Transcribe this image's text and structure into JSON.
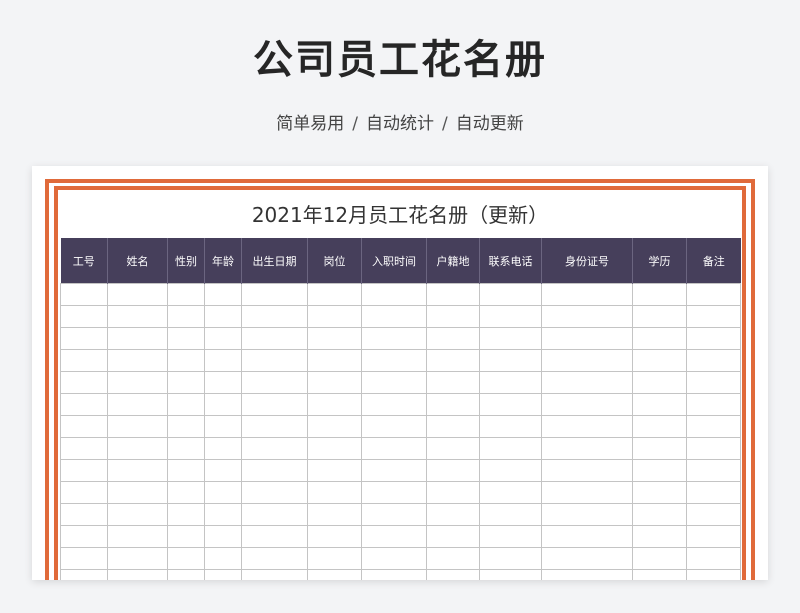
{
  "header": {
    "title": "公司员工花名册",
    "tagline": [
      "简单易用",
      "自动统计",
      "自动更新"
    ],
    "separator": "/"
  },
  "sheet": {
    "title": "2021年12月员工花名册（更新）",
    "columns": [
      "工号",
      "姓名",
      "性别",
      "年龄",
      "出生日期",
      "岗位",
      "入职时间",
      "户籍地",
      "联系电话",
      "身份证号",
      "学历",
      "备注"
    ],
    "rows": [
      [
        "",
        "",
        "",
        "",
        "",
        "",
        "",
        "",
        "",
        "",
        "",
        ""
      ],
      [
        "",
        "",
        "",
        "",
        "",
        "",
        "",
        "",
        "",
        "",
        "",
        ""
      ],
      [
        "",
        "",
        "",
        "",
        "",
        "",
        "",
        "",
        "",
        "",
        "",
        ""
      ],
      [
        "",
        "",
        "",
        "",
        "",
        "",
        "",
        "",
        "",
        "",
        "",
        ""
      ],
      [
        "",
        "",
        "",
        "",
        "",
        "",
        "",
        "",
        "",
        "",
        "",
        ""
      ],
      [
        "",
        "",
        "",
        "",
        "",
        "",
        "",
        "",
        "",
        "",
        "",
        ""
      ],
      [
        "",
        "",
        "",
        "",
        "",
        "",
        "",
        "",
        "",
        "",
        "",
        ""
      ],
      [
        "",
        "",
        "",
        "",
        "",
        "",
        "",
        "",
        "",
        "",
        "",
        ""
      ],
      [
        "",
        "",
        "",
        "",
        "",
        "",
        "",
        "",
        "",
        "",
        "",
        ""
      ],
      [
        "",
        "",
        "",
        "",
        "",
        "",
        "",
        "",
        "",
        "",
        "",
        ""
      ],
      [
        "",
        "",
        "",
        "",
        "",
        "",
        "",
        "",
        "",
        "",
        "",
        ""
      ],
      [
        "",
        "",
        "",
        "",
        "",
        "",
        "",
        "",
        "",
        "",
        "",
        ""
      ],
      [
        "",
        "",
        "",
        "",
        "",
        "",
        "",
        "",
        "",
        "",
        "",
        ""
      ],
      [
        "",
        "",
        "",
        "",
        "",
        "",
        "",
        "",
        "",
        "",
        "",
        ""
      ]
    ]
  },
  "colors": {
    "accent_border": "#e06a3a",
    "header_fill": "#463f5b",
    "header_text": "#ffffff"
  }
}
